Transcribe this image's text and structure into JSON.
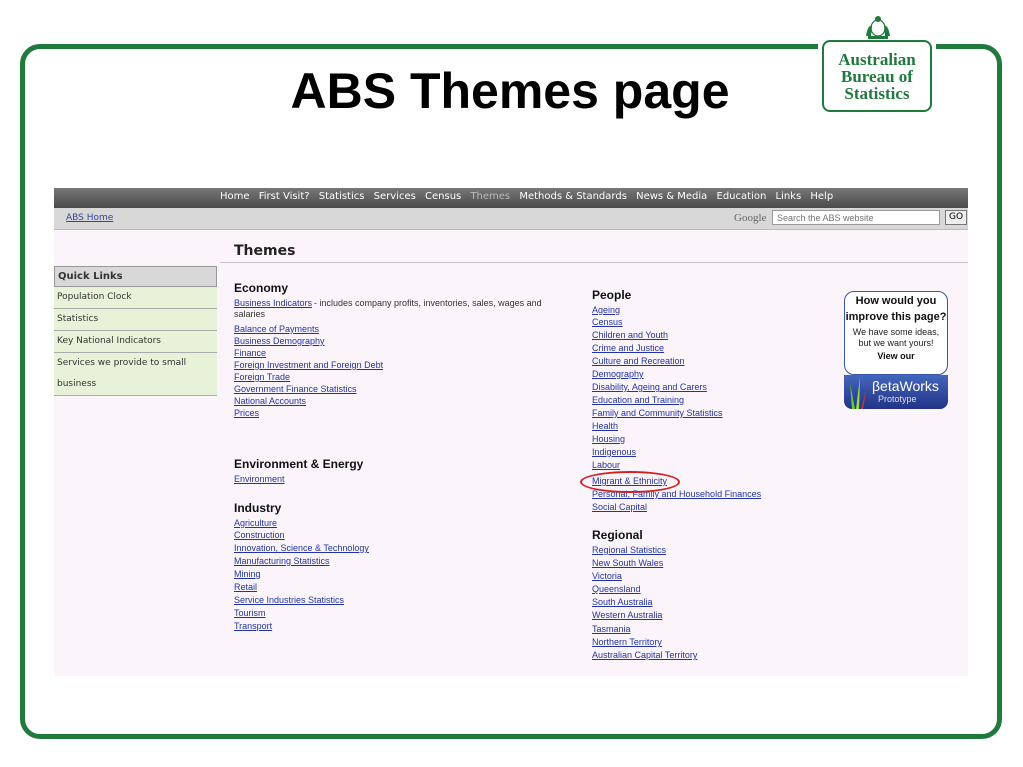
{
  "slide": {
    "title": "ABS Themes page",
    "logo": [
      "Australian",
      "Bureau of",
      "Statistics"
    ],
    "frame_color": "#1f7a3c"
  },
  "nav": {
    "items": [
      "Home",
      "First Visit?",
      "Statistics",
      "Services",
      "Census",
      "Themes",
      "Methods & Standards",
      "News & Media",
      "Education",
      "Links",
      "Help"
    ],
    "active": "Themes"
  },
  "subbar": {
    "home_link": "ABS Home",
    "google": "Google",
    "search_placeholder": "Search the ABS website",
    "go": "GO"
  },
  "page_title": "Themes",
  "quick_links": {
    "heading": "Quick Links",
    "items": [
      "Population Clock",
      "Statistics",
      "Key National Indicators",
      "Services we provide to small",
      "business"
    ]
  },
  "economy": {
    "heading": "Economy",
    "first_link": "Business Indicators",
    "first_desc": " - includes company profits, inventories, sales, wages and",
    "first_desc2": "salaries",
    "links": [
      "Balance of Payments",
      "Business Demography",
      "Finance",
      "Foreign Investment and Foreign Debt",
      "Foreign Trade",
      "Government Finance Statistics",
      "National Accounts",
      "Prices"
    ]
  },
  "environment": {
    "heading": "Environment & Energy",
    "links": [
      "Environment"
    ]
  },
  "industry": {
    "heading": "Industry",
    "links": [
      "Agriculture",
      "Construction",
      "Innovation, Science & Technology",
      "Manufacturing Statistics",
      "Mining",
      "Retail",
      "Service Industries Statistics",
      "Tourism",
      "Transport"
    ]
  },
  "people": {
    "heading": "People",
    "links": [
      "Ageing",
      "Census",
      "Children and Youth",
      "Crime and Justice",
      "Culture and Recreation",
      "Demography",
      "Disability, Ageing and Carers",
      "Education and Training",
      "Family and Community Statistics",
      "Health",
      "Housing",
      "Indigenous",
      "Labour",
      "Migrant & Ethnicity",
      "Personal, Family and Household Finances",
      "Social Capital"
    ]
  },
  "regional": {
    "heading": "Regional",
    "links": [
      "Regional Statistics",
      "New South Wales",
      "Victoria",
      "Queensland",
      "South Australia",
      "Western Australia",
      "Tasmania",
      "Northern Territory",
      "Australian Capital Territory"
    ]
  },
  "promo": {
    "line1": "How would you",
    "line2": "improve this page?",
    "line3": "We have some ideas,",
    "line4": "but we want yours!",
    "view": "View our",
    "beta": "βetaWorks",
    "prototype": "Prototype"
  }
}
